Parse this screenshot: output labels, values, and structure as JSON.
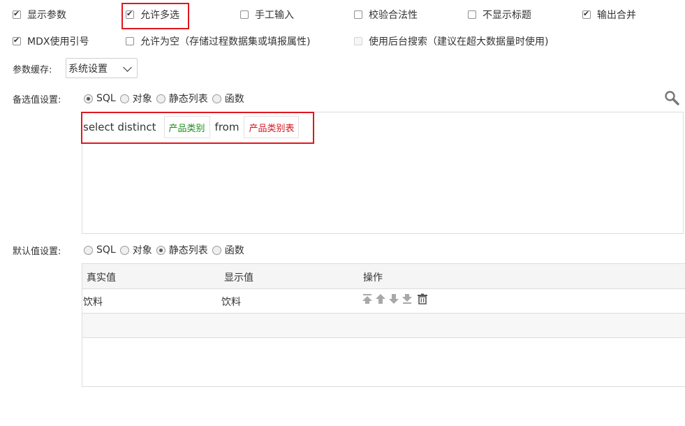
{
  "options": {
    "row1": [
      {
        "label": "显示参数",
        "checked": true
      },
      {
        "label": "允许多选",
        "checked": true
      },
      {
        "label": "手工输入",
        "checked": false
      },
      {
        "label": "校验合法性",
        "checked": false
      },
      {
        "label": "不显示标题",
        "checked": false
      },
      {
        "label": "输出合并",
        "checked": true
      }
    ],
    "row2": [
      {
        "label": "MDX使用引号",
        "checked": true
      },
      {
        "label": "允许为空（存储过程数据集或填报属性)",
        "checked": false
      },
      {
        "label": "使用后台搜索（建议在超大数据量时使用)",
        "checked": false,
        "disabled": true
      }
    ]
  },
  "param_cache": {
    "label": "参数缓存:",
    "value": "系统设置"
  },
  "candidate": {
    "label": "备选值设置:",
    "radios": [
      {
        "label": "SQL",
        "selected": true
      },
      {
        "label": "对象",
        "selected": false
      },
      {
        "label": "静态列表",
        "selected": false
      },
      {
        "label": "函数",
        "selected": false
      }
    ],
    "sql": {
      "prefix": "select distinct",
      "field": "产品类别",
      "from": "from",
      "table": "产品类别表"
    }
  },
  "default": {
    "label": "默认值设置:",
    "radios": [
      {
        "label": "SQL",
        "selected": false
      },
      {
        "label": "对象",
        "selected": false
      },
      {
        "label": "静态列表",
        "selected": true
      },
      {
        "label": "函数",
        "selected": false
      }
    ],
    "table": {
      "headers": [
        "真实值",
        "显示值",
        "操作"
      ],
      "rows": [
        {
          "real": "饮料",
          "display": "饮料"
        }
      ]
    }
  },
  "icons": {
    "search": "search-icon",
    "move_top": "move-top-icon",
    "move_up": "move-up-icon",
    "move_down": "move-down-icon",
    "move_bottom": "move-bottom-icon",
    "delete": "trash-icon"
  },
  "colors": {
    "highlight_border": "#e0161e",
    "field_chip": "#1a8a1a",
    "table_chip": "#d4161e"
  }
}
